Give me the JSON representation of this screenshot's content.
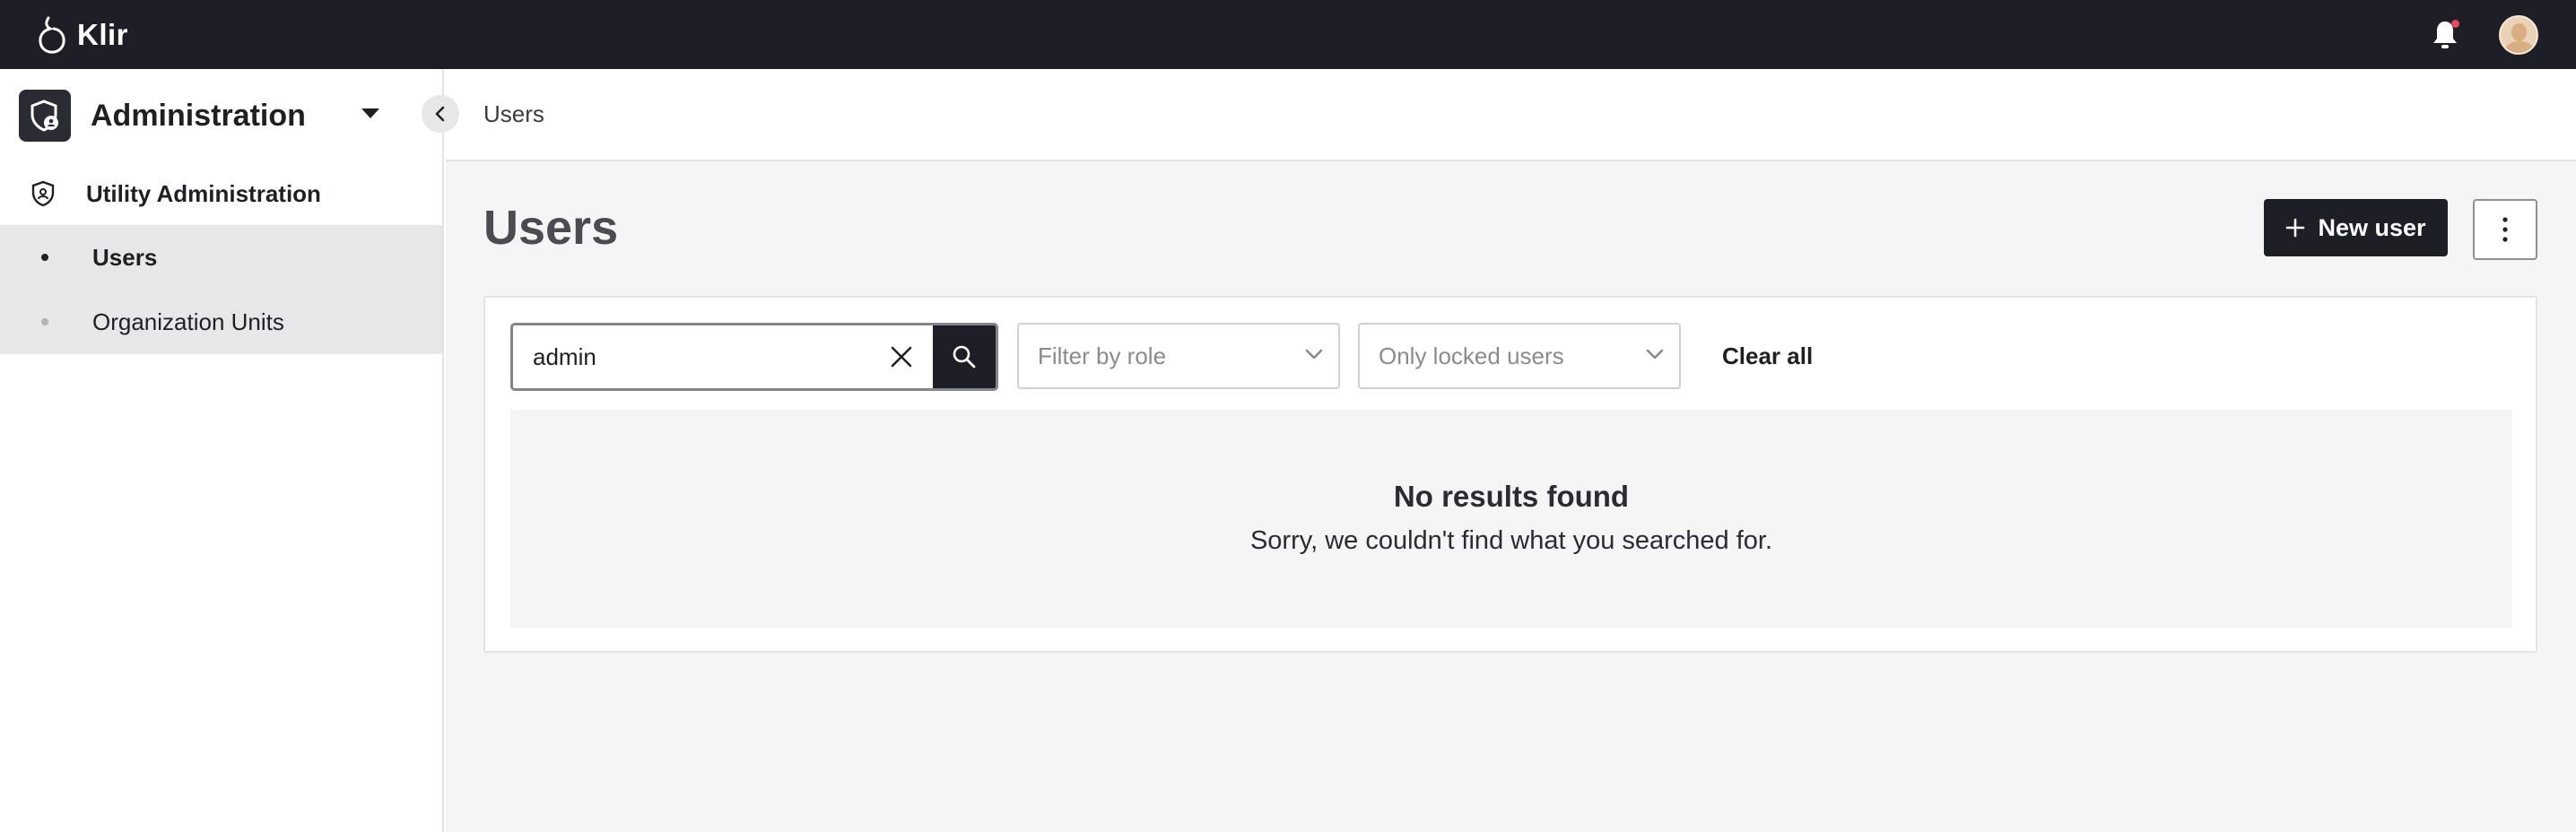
{
  "app": {
    "name": "Klir"
  },
  "topbar": {
    "notification_dot_color": "#e8475c"
  },
  "sidebar": {
    "module_title": "Administration",
    "group_label": "Utility Administration",
    "items": [
      {
        "label": "Users",
        "active": true
      },
      {
        "label": "Organization Units",
        "active": false
      }
    ]
  },
  "breadcrumb": {
    "current": "Users"
  },
  "page": {
    "title": "Users"
  },
  "actions": {
    "new_user_label": "New user"
  },
  "filters": {
    "search_value": "admin",
    "role_placeholder": "Filter by role",
    "locked_placeholder": "Only locked users",
    "clear_all_label": "Clear all"
  },
  "empty_state": {
    "title": "No results found",
    "message": "Sorry, we couldn't find what you searched for."
  }
}
